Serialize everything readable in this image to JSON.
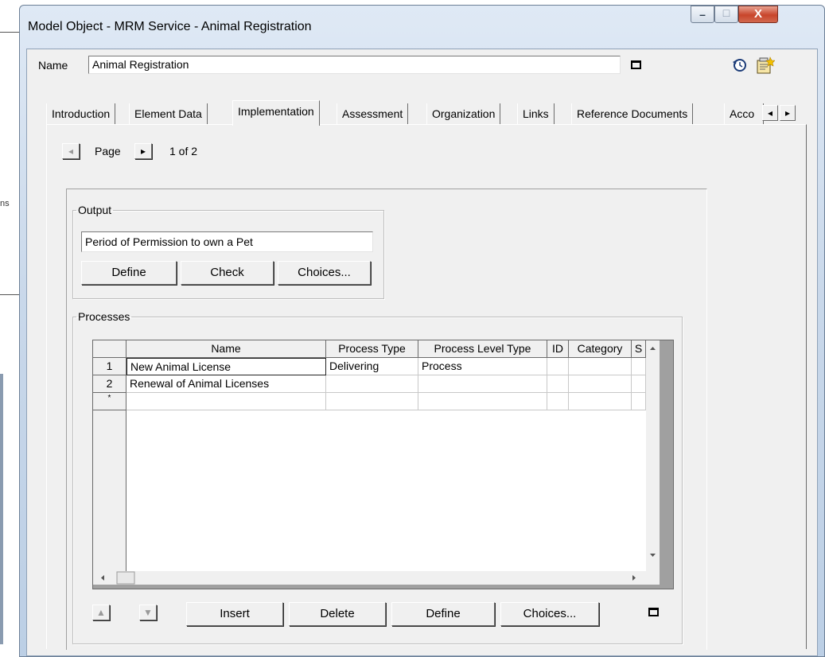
{
  "window": {
    "title": "Model Object - MRM Service - Animal Registration",
    "minimize_glyph": "–",
    "maximize_glyph": "□",
    "close_glyph": "X"
  },
  "name_field": {
    "label": "Name",
    "value": "Animal Registration"
  },
  "toolbar_icons": [
    "history-icon",
    "properties-icon"
  ],
  "tabs": [
    {
      "label": "Introduction"
    },
    {
      "label": "Element Data"
    },
    {
      "label": "Implementation",
      "active": true
    },
    {
      "label": "Assessment"
    },
    {
      "label": "Organization"
    },
    {
      "label": "Links"
    },
    {
      "label": "Reference Documents"
    },
    {
      "label": "Acco"
    }
  ],
  "tab_scroll": {
    "left_glyph": "◂",
    "right_glyph": "▸"
  },
  "pager": {
    "prev_glyph": "◂",
    "label": "Page",
    "next_glyph": "▸",
    "status": "1 of 2"
  },
  "output": {
    "legend": "Output",
    "value": "Period of Permission to own a Pet",
    "define_label": "Define",
    "check_label": "Check",
    "choices_label": "Choices..."
  },
  "processes": {
    "legend": "Processes",
    "columns": [
      "Name",
      "Process Type",
      "Process Level Type",
      "ID",
      "Category",
      "S"
    ],
    "rows": [
      {
        "num": "1",
        "name": "New Animal License",
        "process_type": "Delivering",
        "level_type": "Process",
        "id": "",
        "category": "",
        "s": ""
      },
      {
        "num": "2",
        "name": "Renewal of Animal Licenses",
        "process_type": "",
        "level_type": "",
        "id": "",
        "category": "",
        "s": ""
      }
    ],
    "new_row_marker": "*",
    "up_glyph": "▲",
    "down_glyph": "▼",
    "insert_label": "Insert",
    "delete_label": "Delete",
    "define_label": "Define",
    "choices_label": "Choices..."
  },
  "background_text": "ns"
}
